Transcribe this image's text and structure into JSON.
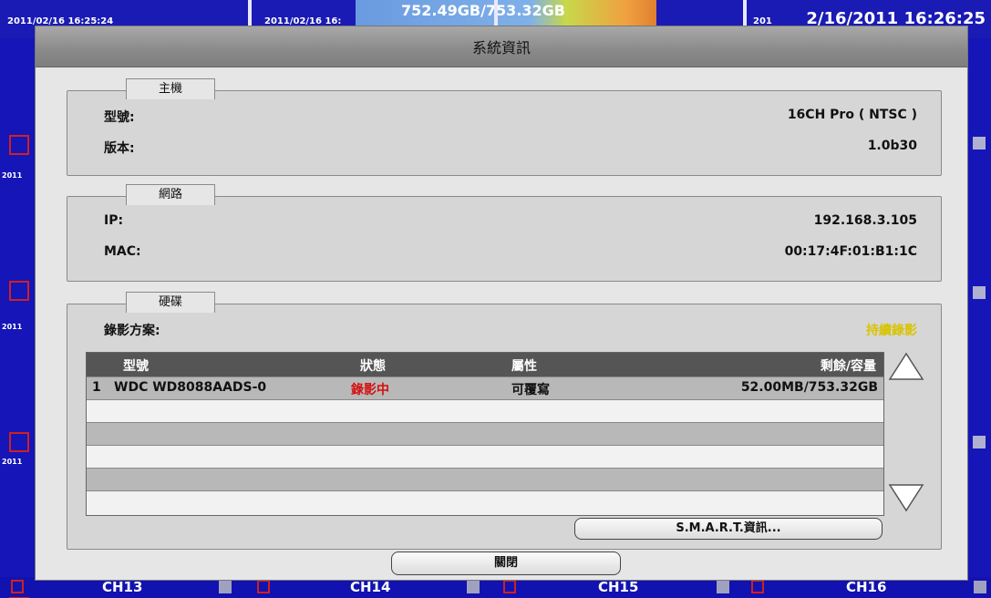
{
  "background": {
    "timestamps_small": [
      "2011/02/16 16:25:24",
      "2011/02/16 16:",
      "2011"
    ],
    "hdd_usage": "752.49GB/753.32GB",
    "clock_big": "2/16/2011 16:26:25",
    "clock_prefix": "201",
    "cam_date": "2011",
    "channels": [
      "CH13",
      "CH14",
      "CH15",
      "CH16"
    ]
  },
  "dialog": {
    "title": "系統資訊",
    "host": {
      "tab": "主機",
      "model_label": "型號:",
      "model_value": "16CH Pro ( NTSC )",
      "version_label": "版本:",
      "version_value": "1.0b30"
    },
    "network": {
      "tab": "網路",
      "ip_label": "IP:",
      "ip_value": "192.168.3.105",
      "mac_label": "MAC:",
      "mac_value": "00:17:4F:01:B1:1C"
    },
    "disk": {
      "tab": "硬碟",
      "rec_label": "錄影方案:",
      "rec_value": "持續錄影",
      "columns": [
        "型號",
        "狀態",
        "屬性",
        "剩餘/容量"
      ],
      "rows": [
        {
          "index": "1",
          "model": "WDC WD8088AADS-0",
          "status": "錄影中",
          "attr": "可覆寫",
          "capacity": "52.00MB/753.32GB"
        }
      ],
      "smart_button": "S.M.A.R.T.資訊..."
    },
    "close_button": "關閉"
  },
  "colors": {
    "accent_status": "#d41010",
    "rec_mode": "#d8c400"
  }
}
